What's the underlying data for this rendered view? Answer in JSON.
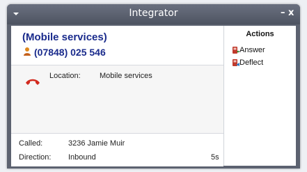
{
  "window": {
    "title": "Integrator",
    "minimize_label": "–",
    "close_label": "x"
  },
  "caller": {
    "name": "(Mobile services)",
    "number": "(07848) 025 546"
  },
  "details": {
    "location_label": "Location:",
    "location_value": "Mobile services"
  },
  "footer": {
    "called_label": "Called:",
    "called_value": "3236  Jamie Muir",
    "direction_label": "Direction:",
    "direction_value": "Inbound",
    "duration": "5s"
  },
  "actions": {
    "title": "Actions",
    "items": [
      {
        "label": "Answer",
        "icon": "answer-icon"
      },
      {
        "label": "Deflect",
        "icon": "deflect-icon"
      }
    ]
  },
  "colors": {
    "titlebar": "#5c6270",
    "caller_text": "#1a2b8c",
    "phone_icon": "#d22a1e"
  }
}
